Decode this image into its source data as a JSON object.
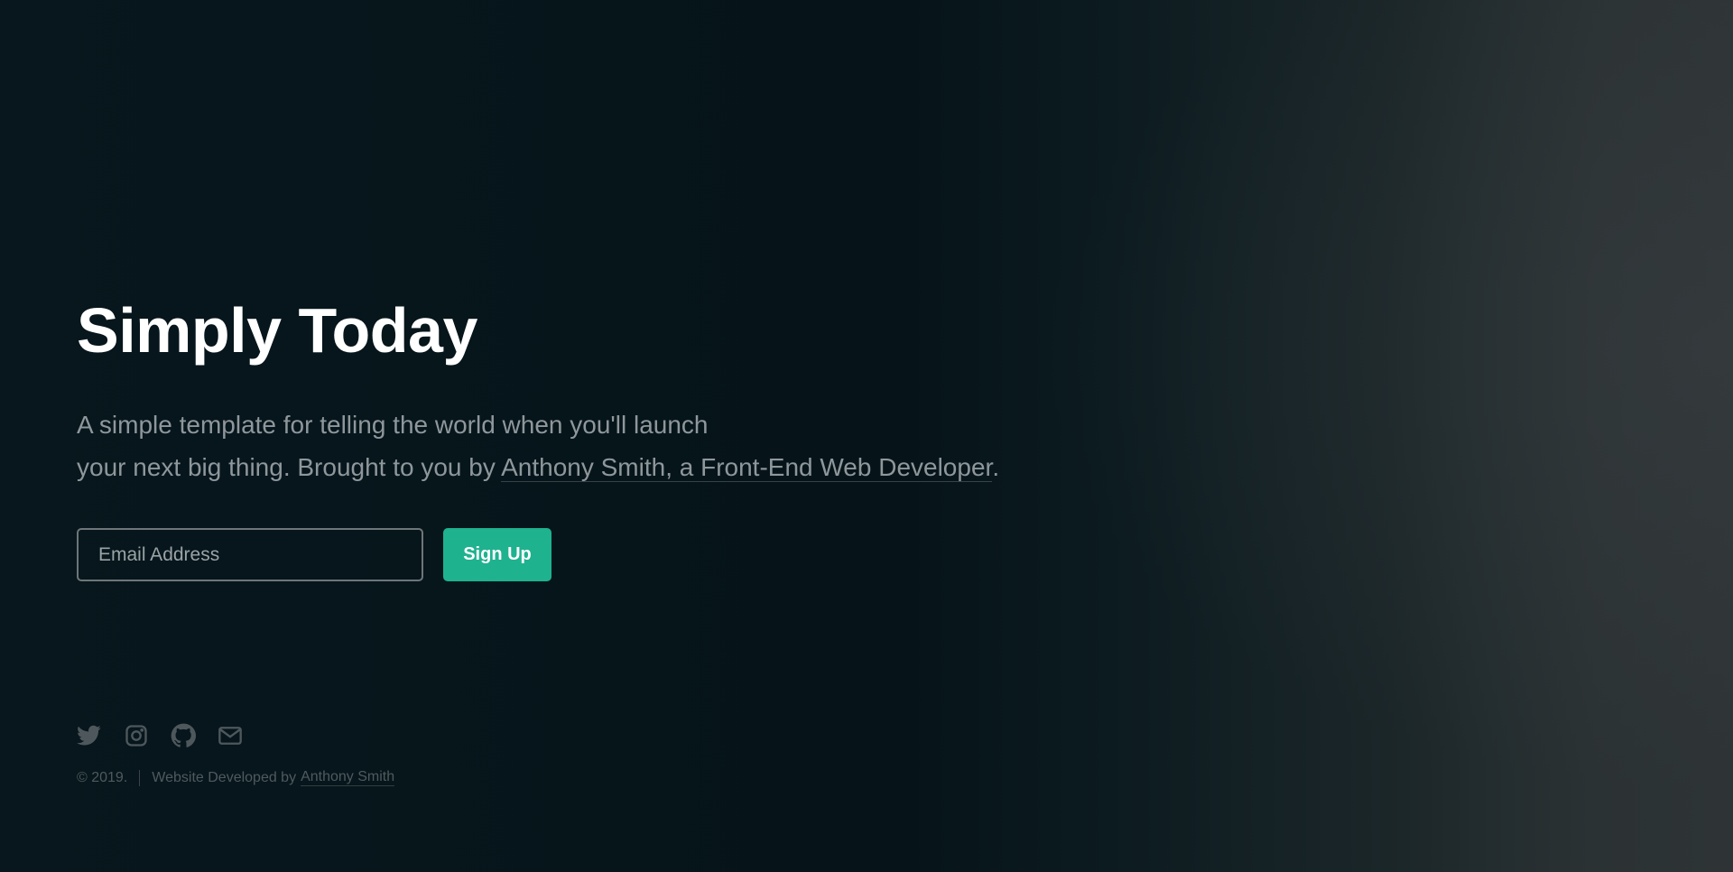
{
  "hero": {
    "title": "Simply Today",
    "description_line1": "A simple template for telling the world when you'll launch",
    "description_line2_prefix": "your next big thing. Brought to you by ",
    "description_link": "Anthony Smith, a Front-End Web Developer",
    "description_suffix": "."
  },
  "signup_form": {
    "email_placeholder": "Email Address",
    "button_label": "Sign Up"
  },
  "social_icons": [
    "twitter-icon",
    "instagram-icon",
    "github-icon",
    "mail-icon"
  ],
  "footer": {
    "copyright": "© 2019.",
    "credit_prefix": "Website Developed by",
    "credit_link": "Anthony Smith"
  },
  "colors": {
    "accent": "#1fb28f",
    "background_dark": "#061419",
    "background_light": "#2e3436",
    "muted_text": "#8e979b"
  }
}
